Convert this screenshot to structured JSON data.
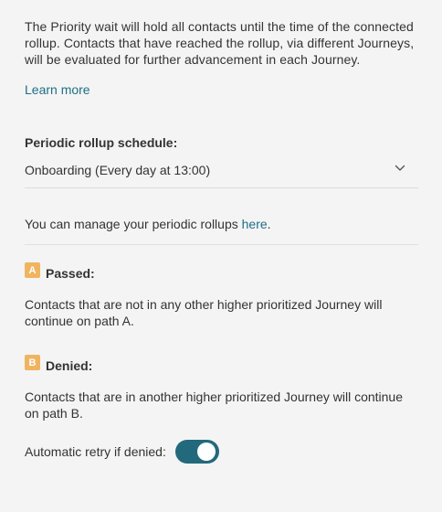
{
  "intro_text": "The Priority wait will hold all contacts until the time of the connected rollup. Contacts that have reached the rollup, via different Journeys, will be evaluated for further advancement in each Journey.",
  "learn_more_label": "Learn more",
  "rollup": {
    "label": "Periodic rollup schedule:",
    "selected_value": "Onboarding (Every day at 13:00)",
    "chevron_icon": "chevron-down-icon"
  },
  "manage": {
    "text": "You can manage your periodic rollups ",
    "link_label": "here",
    "suffix": "."
  },
  "paths": {
    "a": {
      "badge": "A",
      "title": "Passed:",
      "description": "Contacts that are not in any other higher prioritized Journey will continue on path A."
    },
    "b": {
      "badge": "B",
      "title": "Denied:",
      "description": "Contacts that are in another higher prioritized Journey will continue on path B."
    }
  },
  "retry": {
    "label": "Automatic retry if denied:",
    "enabled": true
  },
  "colors": {
    "link": "#1e6f86",
    "badge": "#f0b460",
    "toggle_on": "#23697c"
  }
}
